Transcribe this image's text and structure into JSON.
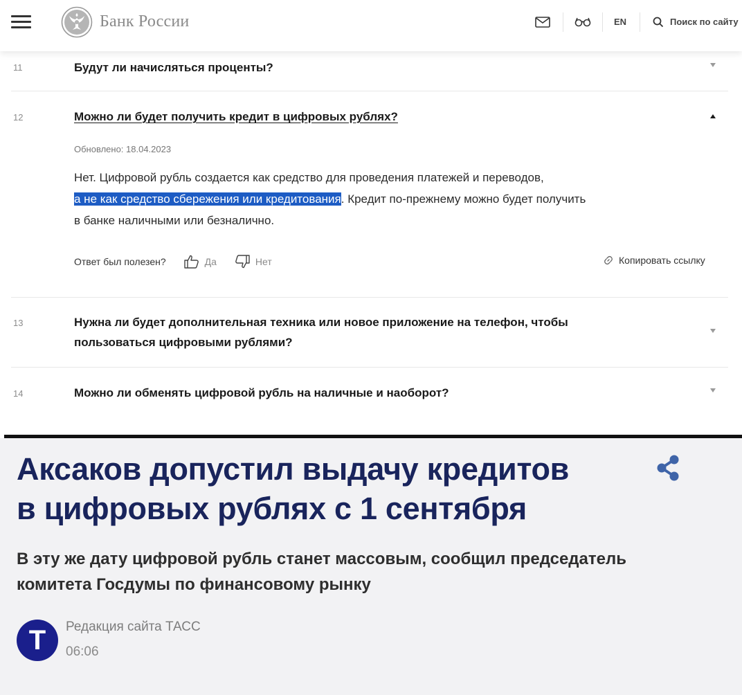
{
  "header": {
    "logo_text": "Банк России",
    "lang_label": "EN",
    "search_label": "Поиск по сайту",
    "icons": [
      "menu-icon",
      "emblem-icon",
      "mail-icon",
      "glasses-icon",
      "search-icon"
    ]
  },
  "faq": {
    "items": [
      {
        "num": "11",
        "question": "Будут ли начисляться проценты?",
        "state": "collapsed"
      },
      {
        "num": "12",
        "question": "Можно ли будет получить кредит в цифровых рублях?",
        "state": "expanded"
      },
      {
        "num": "13",
        "question_line1": "Нужна ли будет дополнительная техника или новое приложение на телефон, чтобы",
        "question_line2": "пользоваться цифровыми рублями?",
        "state": "collapsed"
      },
      {
        "num": "14",
        "question": "Можно ли обменять цифровой рубль на наличные и наоборот?",
        "state": "collapsed"
      }
    ],
    "expanded": {
      "updated": "Обновлено: 18.04.2023",
      "answer_line1": "Нет. Цифровой рубль создается как средство для проведения платежей и переводов,",
      "answer_highlight": "а не как средство сбережения или кредитования",
      "answer_rest": ". Кредит по-прежнему можно будет получить",
      "answer_line3": "в банке наличными или безналично.",
      "feedback_label": "Ответ был полезен?",
      "yes_label": "Да",
      "no_label": "Нет",
      "copy_link_label": "Копировать ссылку"
    }
  },
  "article": {
    "headline_line1": "Аксаков допустил выдачу кредитов",
    "headline_line2": "в цифровых рублях с 1 сентября",
    "lead_line1": "В эту же дату цифровой рубль станет массовым, сообщил председатель",
    "lead_line2": "комитета Госдумы по финансовому рынку",
    "avatar_letter": "Т",
    "author": "Редакция сайта ТАСС",
    "time": "06:06"
  },
  "colors": {
    "headline": "#19245c",
    "highlight": "#1d5cc4",
    "avatar": "#1a1f8c",
    "article_bg": "#f2f2f4"
  }
}
